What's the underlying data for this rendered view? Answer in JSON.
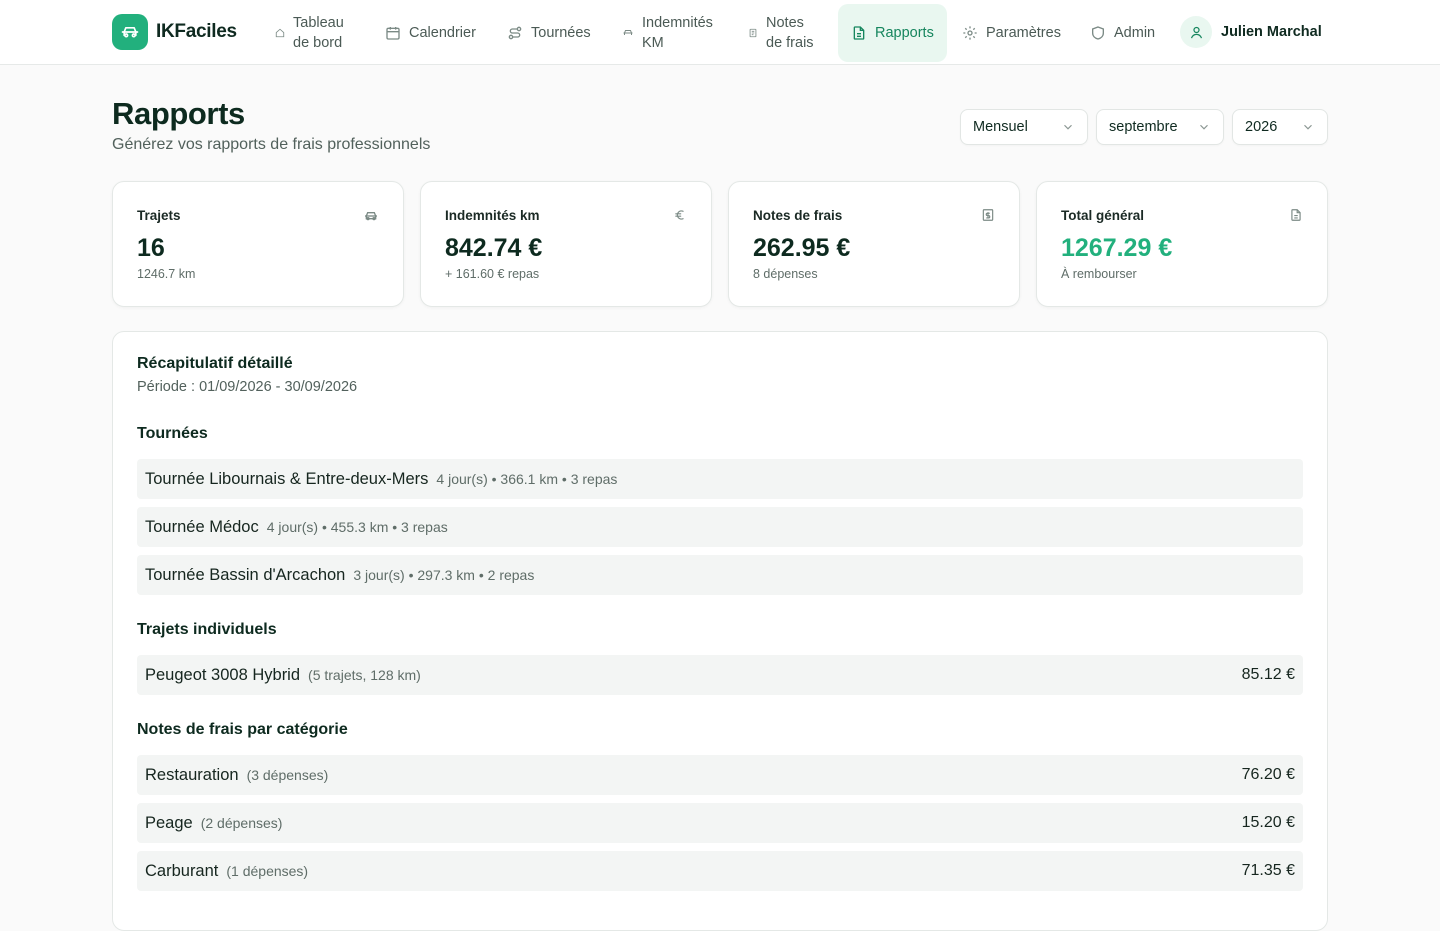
{
  "brand": {
    "name": "IKFaciles"
  },
  "nav": {
    "dashboard": [
      "Tableau",
      "de bord"
    ],
    "calendar": "Calendrier",
    "tours": "Tournées",
    "km_allowances": [
      "Indemnités",
      "KM"
    ],
    "expense_notes": [
      "Notes",
      "de frais"
    ],
    "reports": "Rapports",
    "settings": "Paramètres",
    "admin": "Admin",
    "user": "Julien Marchal"
  },
  "header": {
    "title": "Rapports",
    "subtitle": "Générez vos rapports de frais professionnels",
    "filters": {
      "period": "Mensuel",
      "month": "septembre",
      "year": "2026"
    }
  },
  "stats": [
    {
      "label": "Trajets",
      "value": "16",
      "sub": "1246.7 km",
      "icon": "car-icon"
    },
    {
      "label": "Indemnités km",
      "value": "842.74 €",
      "sub": "+ 161.60 € repas",
      "icon": "euro-icon"
    },
    {
      "label": "Notes de frais",
      "value": "262.95 €",
      "sub": "8 dépenses",
      "icon": "receipt-icon"
    },
    {
      "label": "Total général",
      "value": "1267.29 €",
      "sub": "À rembourser",
      "icon": "document-icon"
    }
  ],
  "summary": {
    "title": "Récapitulatif détaillé",
    "period": "Période : 01/09/2026 - 30/09/2026",
    "tours_title": "Tournées",
    "tours": [
      {
        "name": "Tournée Libournais & Entre-deux-Mers",
        "meta": "4 jour(s) • 366.1 km • 3 repas"
      },
      {
        "name": "Tournée Médoc",
        "meta": "4 jour(s) • 455.3 km • 3 repas"
      },
      {
        "name": "Tournée Bassin d'Arcachon",
        "meta": "3 jour(s) • 297.3 km • 2 repas"
      }
    ],
    "trips_title": "Trajets individuels",
    "trips": [
      {
        "name": "Peugeot 3008 Hybrid",
        "meta": "(5 trajets, 128 km)",
        "amount": "85.12 €"
      }
    ],
    "categories_title": "Notes de frais par catégorie",
    "categories": [
      {
        "name": "Restauration",
        "meta": "(3 dépenses)",
        "amount": "76.20 €"
      },
      {
        "name": "Peage",
        "meta": "(2 dépenses)",
        "amount": "15.20 €"
      },
      {
        "name": "Carburant",
        "meta": "(1 dépenses)",
        "amount": "71.35 €"
      }
    ]
  }
}
